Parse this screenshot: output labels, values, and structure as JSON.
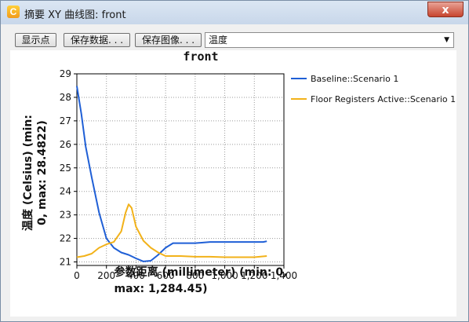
{
  "window": {
    "title": "摘要 XY 曲线图: front",
    "close_label": "x",
    "app_icon_glyph": "C"
  },
  "toolbar": {
    "show_points": "显示点",
    "save_data": "保存数据. . .",
    "save_image": "保存图像. . .",
    "variable_selected": "温度"
  },
  "chart_data": {
    "type": "line",
    "title": "front",
    "xlabel_line1": "参数距离 (millimeter) (min: 0,",
    "xlabel_line2": "max: 1,284.45)",
    "ylabel_line1": "温度 (Celsius) (min:",
    "ylabel_line2": "0, max: 28.4822)",
    "xlim": [
      0,
      1400
    ],
    "ylim": [
      20.85,
      29
    ],
    "xticks": [
      0,
      200,
      400,
      600,
      800,
      1000,
      1200,
      1400
    ],
    "xtick_labels": [
      "0",
      "200",
      "400",
      "600",
      "800",
      "1,000",
      "1,200",
      "1,400"
    ],
    "yticks": [
      21,
      22,
      23,
      24,
      25,
      26,
      27,
      28,
      29
    ],
    "ytick_labels": [
      "21",
      "22",
      "23",
      "24",
      "25",
      "26",
      "27",
      "28",
      "29"
    ],
    "grid": true,
    "legend": "right",
    "series": [
      {
        "name": "Baseline::Scenario 1",
        "color": "#1f5fd6",
        "points": [
          [
            0,
            28.48
          ],
          [
            30,
            27.3
          ],
          [
            60,
            25.9
          ],
          [
            100,
            24.6
          ],
          [
            150,
            23.1
          ],
          [
            200,
            22.0
          ],
          [
            250,
            21.6
          ],
          [
            300,
            21.4
          ],
          [
            350,
            21.3
          ],
          [
            400,
            21.15
          ],
          [
            450,
            21.02
          ],
          [
            500,
            21.05
          ],
          [
            550,
            21.3
          ],
          [
            600,
            21.6
          ],
          [
            650,
            21.8
          ],
          [
            700,
            21.8
          ],
          [
            800,
            21.8
          ],
          [
            900,
            21.85
          ],
          [
            1000,
            21.85
          ],
          [
            1100,
            21.85
          ],
          [
            1200,
            21.85
          ],
          [
            1260,
            21.85
          ],
          [
            1284.45,
            21.88
          ]
        ]
      },
      {
        "name": "Floor Registers Active::Scenario 1",
        "color": "#f2b21a",
        "points": [
          [
            0,
            21.2
          ],
          [
            50,
            21.25
          ],
          [
            100,
            21.35
          ],
          [
            150,
            21.6
          ],
          [
            200,
            21.75
          ],
          [
            250,
            21.85
          ],
          [
            300,
            22.3
          ],
          [
            330,
            23.1
          ],
          [
            350,
            23.45
          ],
          [
            370,
            23.3
          ],
          [
            400,
            22.5
          ],
          [
            450,
            21.9
          ],
          [
            500,
            21.6
          ],
          [
            550,
            21.4
          ],
          [
            600,
            21.25
          ],
          [
            700,
            21.25
          ],
          [
            800,
            21.22
          ],
          [
            900,
            21.22
          ],
          [
            1000,
            21.2
          ],
          [
            1100,
            21.2
          ],
          [
            1200,
            21.2
          ],
          [
            1284.45,
            21.25
          ]
        ]
      }
    ]
  }
}
